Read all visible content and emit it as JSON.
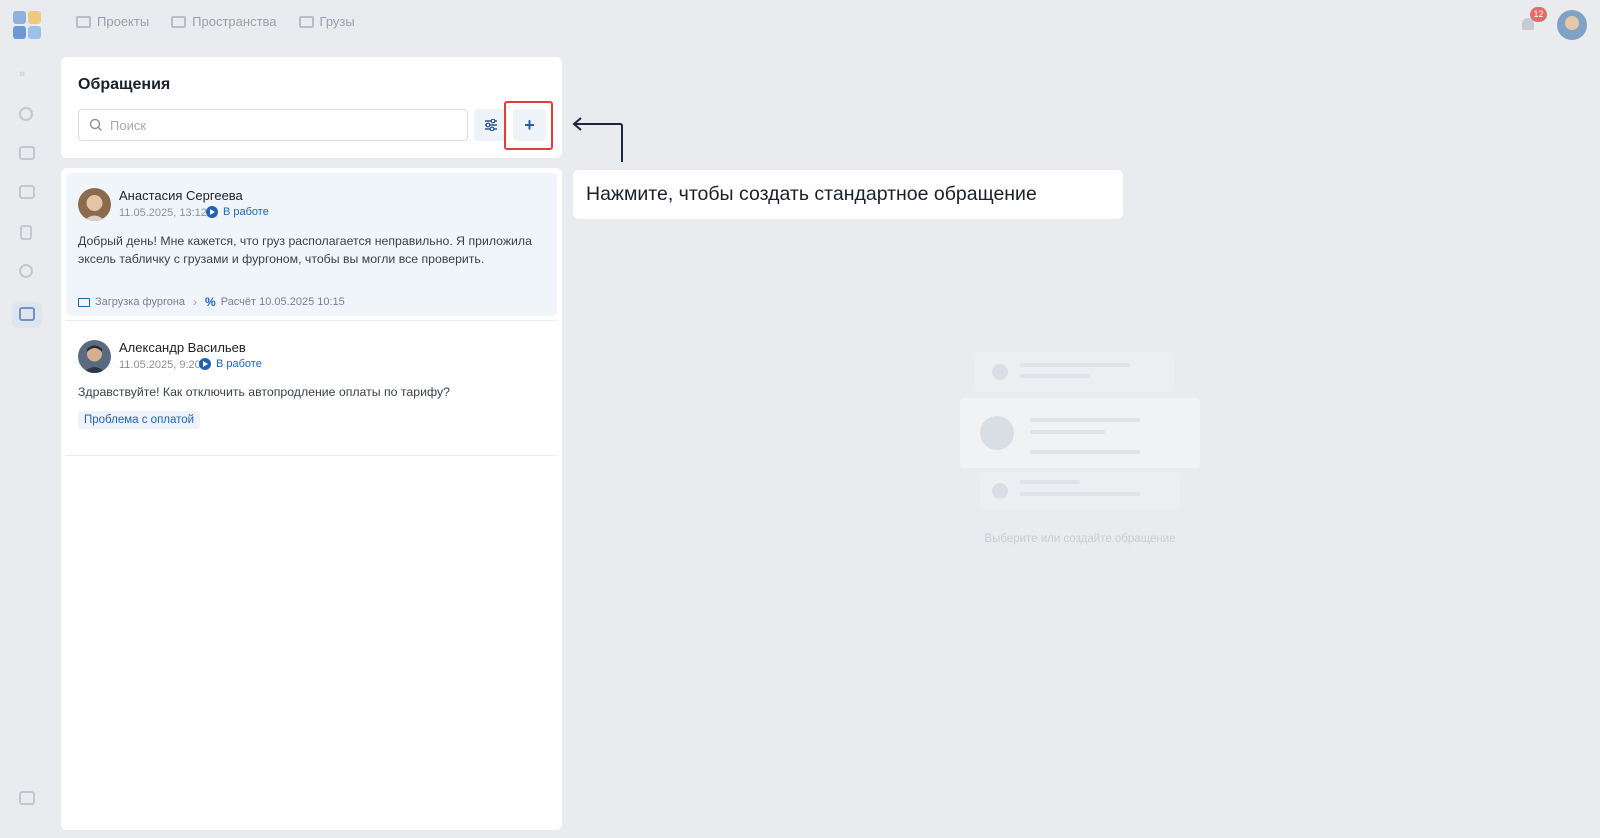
{
  "topbar": {
    "nav": [
      {
        "label": "Проекты",
        "icon": "folder-icon"
      },
      {
        "label": "Пространства",
        "icon": "cube-icon"
      },
      {
        "label": "Грузы",
        "icon": "box-icon"
      }
    ],
    "notifications_count": "12"
  },
  "sidebar": {
    "items": [
      "collapse-icon",
      "user-icon",
      "briefcase-icon",
      "image-icon",
      "document-icon",
      "help-icon",
      "chat-icon"
    ],
    "active": "chat-icon",
    "bottom": "logout-icon"
  },
  "requests_panel": {
    "title": "Обращения",
    "search_placeholder": "Поиск",
    "add_label": "+"
  },
  "tickets": [
    {
      "name": "Анастасия Сергеева",
      "date": "11.05.2025, 13:12",
      "status": "В работе",
      "text": "Добрый день! Мне кажется, что груз располагается неправильно. Я приложила эксель табличку с грузами и фургоном, чтобы вы могли все проверить.",
      "project": "Загрузка фургона",
      "calculation": "Расчёт 10.05.2025 10:15"
    },
    {
      "name": "Александр Васильев",
      "date": "11.05.2025, 9:20",
      "status": "В работе",
      "text": "Здравствуйте! Как отключить автопродление оплаты по тарифу?",
      "tag": "Проблема с оплатой"
    }
  ],
  "callout": {
    "text": "Нажмите, чтобы создать стандартное обращение"
  },
  "empty_state": {
    "text": "Выберите или создайте обращение"
  },
  "colors": {
    "accent": "#1f63b5",
    "highlight": "#e23b3b",
    "overlay_bg": "#e9ebee"
  }
}
